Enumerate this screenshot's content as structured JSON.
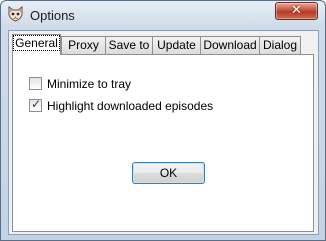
{
  "window": {
    "title": "Options",
    "close_glyph": "✕",
    "app_icon": "cat-face-icon"
  },
  "tabs": [
    {
      "label": "General",
      "active": true
    },
    {
      "label": "Proxy",
      "active": false
    },
    {
      "label": "Save to",
      "active": false
    },
    {
      "label": "Update",
      "active": false
    },
    {
      "label": "Download",
      "active": false
    },
    {
      "label": "Dialog",
      "active": false
    }
  ],
  "general": {
    "minimize_to_tray": {
      "label": "Minimize to tray",
      "checked": false
    },
    "highlight_downloaded": {
      "label": "Highlight downloaded episodes",
      "checked": true
    },
    "ok_label": "OK",
    "check_glyph": "✓"
  },
  "colors": {
    "title_bar": "#cfdbe9",
    "close_button": "#c7513c",
    "panel": "#ffffff",
    "focus_border": "#3c7fb1"
  }
}
